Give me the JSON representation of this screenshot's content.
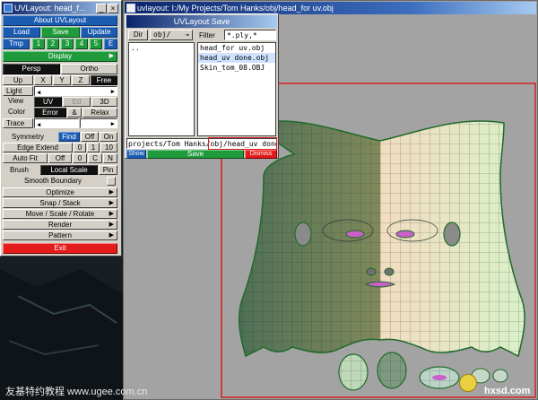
{
  "uv_window": {
    "title": "UVLayout: head_f...",
    "header": "About UVLayout",
    "load": "Load",
    "save": "Save",
    "update": "Update",
    "tmp_label": "Tmp",
    "tmp_slots": [
      "1",
      "2",
      "3",
      "4",
      "5",
      "E"
    ],
    "display_header": "Display",
    "persp": "Persp",
    "ortho": "Ortho",
    "axes": [
      "Up",
      "X",
      "Y",
      "Z",
      "Free"
    ],
    "light": "Light",
    "view_label": "View",
    "view_uv": "UV",
    "view_ed": "Ed",
    "view_3d": "3D",
    "color_label": "Color",
    "color_error": "Error",
    "color_amp": "&",
    "color_relax": "Relax",
    "trace": "Trace",
    "symmetry": "Symmetry",
    "find": "Find",
    "off": "Off",
    "on": "On",
    "edge_extend": "Edge Extend",
    "edge_0": "0",
    "edge_1": "1",
    "edge_10": "10",
    "auto_fit": "Auto Fit",
    "af_off": "Off",
    "af_0": "0",
    "af_c": "C",
    "af_n": "N",
    "brush": "Brush",
    "local_scale": "Local Scale",
    "pin": "Pin",
    "smooth_boundary": "Smooth Boundary",
    "menus": [
      "Optimize",
      "Snap / Stack",
      "Move / Scale / Rotate",
      "Render",
      "Pattern"
    ],
    "exit": "Exit"
  },
  "viewport_window": {
    "title": "uvlayout: I:/My Projects/Tom Hanks/obj/head_for uv.obj"
  },
  "save_dialog": {
    "title": "UVLayout Save",
    "dir_label": "Dir",
    "dir_value": "obj/",
    "filter_label": "Filter",
    "filter_value": "*.ply,*",
    "dirs": [
      ".."
    ],
    "files": [
      "head_for uv.obj",
      "head_uv done.obj",
      "Skin_tom_08.OBJ"
    ],
    "selected_index": 1,
    "path_value": "projects/Tom Hanks/obj/head_uv done.obj",
    "show": "Show",
    "save": "Save",
    "dismiss": "Dismiss"
  },
  "watermark": {
    "left": "友基特约教程  www.ugee.com.cn",
    "right": "hxsd.com"
  },
  "colors": {
    "accent_blue": "#1c5cb0",
    "accent_green": "#1f9b3c",
    "accent_red": "#e31b1b",
    "viewport_bg": "#a3a3a3",
    "frame_red": "#d82020"
  }
}
